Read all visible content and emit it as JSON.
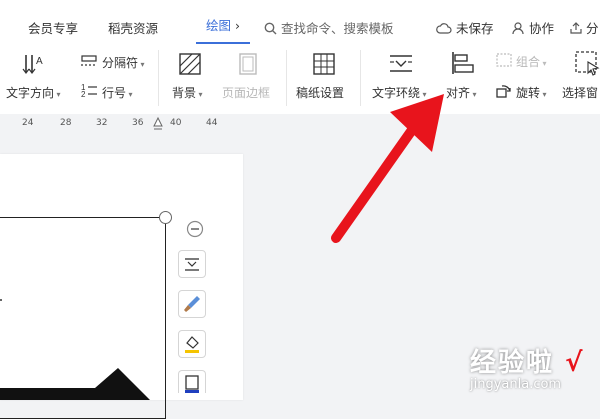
{
  "menubar": {
    "items": [
      "会员专享",
      "稻壳资源"
    ],
    "active_tab": "绘图",
    "search_placeholder": "查找命令、搜索模板",
    "right_items": [
      "未保存",
      "协作",
      "分"
    ]
  },
  "ribbon": {
    "text_direction": "文字方向",
    "separator": "分隔符",
    "line_number": "行号",
    "background": "背景",
    "page_border": "页面边框",
    "manuscript": "稿纸设置",
    "wrap_text": "文字环绕",
    "align": "对齐",
    "group": "组合",
    "rotate": "旋转",
    "select_pane": "选择窗"
  },
  "ruler": {
    "ticks": [
      "24",
      "28",
      "32",
      "36",
      "40",
      "44"
    ]
  },
  "watermark": {
    "cn": "经验啦",
    "en": "jingyanla.com"
  },
  "colors": {
    "accent": "#3b6fd9",
    "arrow": "#e8141c"
  }
}
